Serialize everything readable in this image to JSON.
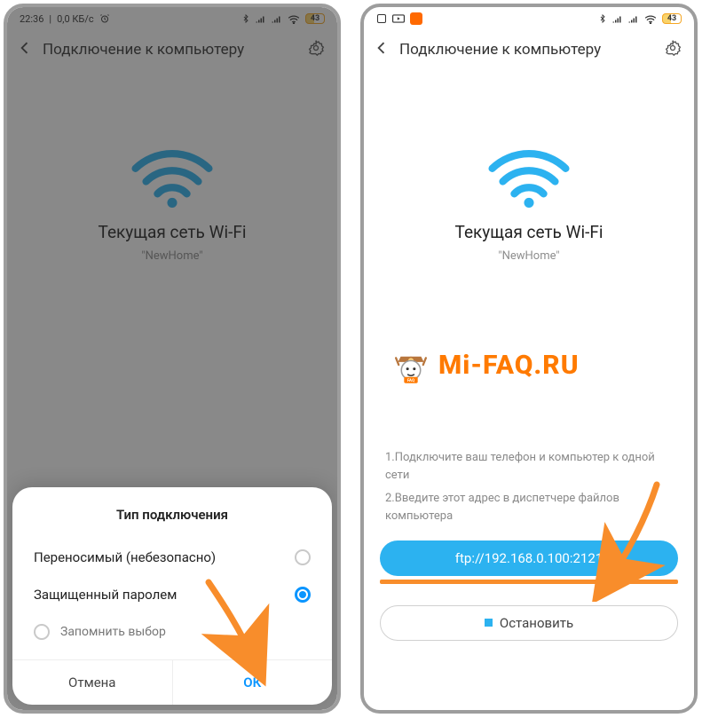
{
  "left": {
    "status": {
      "time": "22:36",
      "net_rate": "0,0 КБ/с",
      "battery": "43"
    },
    "header_title": "Подключение к компьютеру",
    "wifi_title": "Текущая сеть Wi-Fi",
    "wifi_name": "\"NewHome\"",
    "sheet": {
      "title": "Тип подключения",
      "opt_insecure": "Переносимый (небезопасно)",
      "opt_secure": "Защищенный паролем",
      "remember": "Запомнить выбор",
      "cancel": "Отмена",
      "ok": "ОК"
    }
  },
  "right": {
    "status": {
      "battery": "43"
    },
    "header_title": "Подключение к компьютеру",
    "wifi_title": "Текущая сеть Wi-Fi",
    "wifi_name": "\"NewHome\"",
    "instr1": "1.Подключите ваш телефон и компьютер к одной сети",
    "instr2": "2.Введите этот адрес в диспетчере файлов компьютера",
    "ftp": "ftp://192.168.0.100:2121",
    "stop": "Остановить"
  },
  "watermark": "Mi-FAQ.RU"
}
